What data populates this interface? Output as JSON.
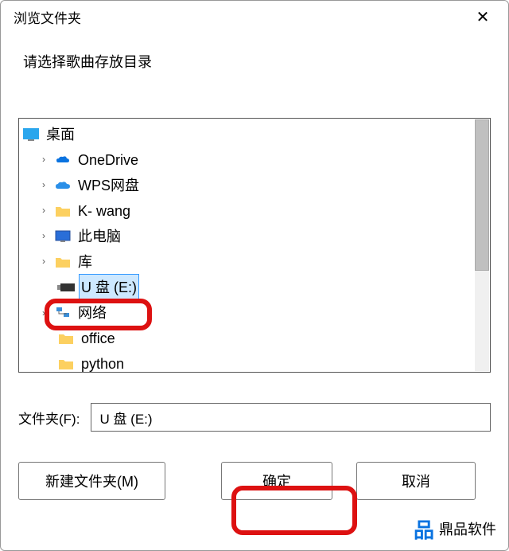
{
  "dialog": {
    "title": "浏览文件夹",
    "instruction": "请选择歌曲存放目录",
    "folder_label": "文件夹(F):",
    "folder_value": "U 盘 (E:)"
  },
  "tree": {
    "root": "桌面",
    "items": [
      {
        "label": "OneDrive",
        "icon": "onedrive"
      },
      {
        "label": "WPS网盘",
        "icon": "wps"
      },
      {
        "label": "K- wang",
        "icon": "folder"
      },
      {
        "label": "此电脑",
        "icon": "pc"
      },
      {
        "label": "库",
        "icon": "folder"
      },
      {
        "label": "U 盘 (E:)",
        "icon": "usb",
        "selected": true
      },
      {
        "label": "网络",
        "icon": "network"
      },
      {
        "label": "office",
        "icon": "folder",
        "noexpand": true
      },
      {
        "label": "python",
        "icon": "folder",
        "noexpand": true
      }
    ]
  },
  "buttons": {
    "new_folder": "新建文件夹(M)",
    "ok": "确定",
    "cancel": "取消"
  },
  "watermark": "鼎品软件"
}
